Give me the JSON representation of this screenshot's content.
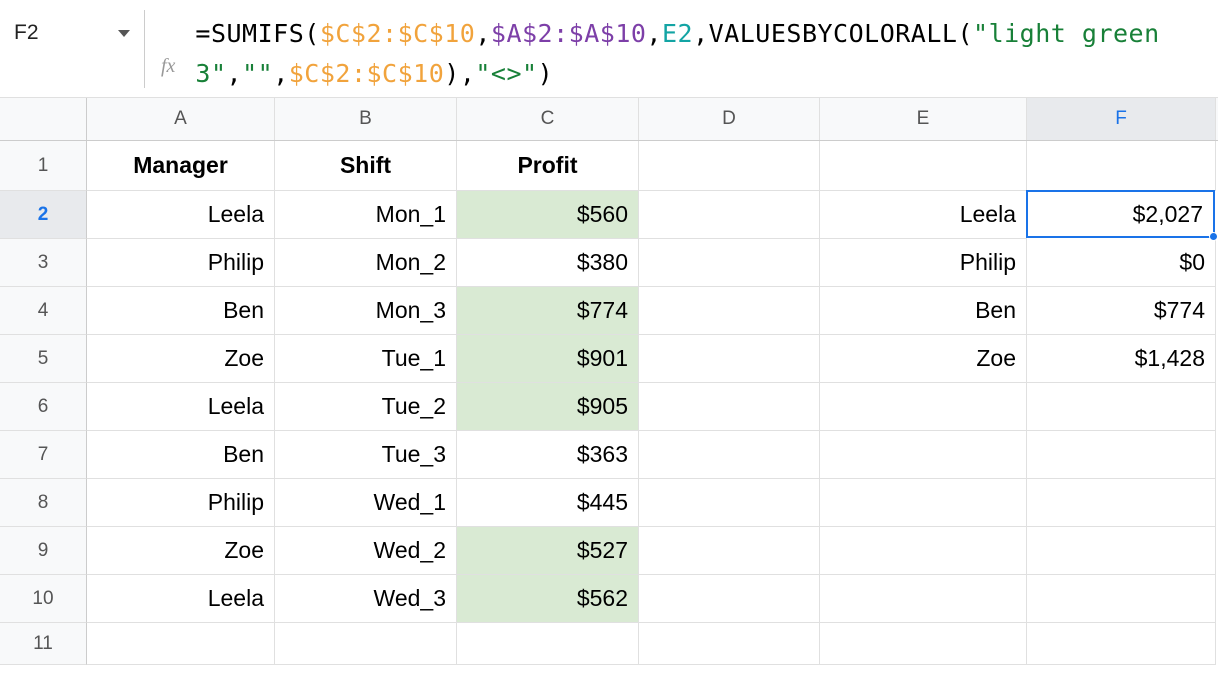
{
  "name_box": "F2",
  "fx_label": "fx",
  "formula": {
    "p1": "=SUMIFS(",
    "p2": "$C$2:$C$10",
    "p3": ",",
    "p4": "$A$2:$A$10",
    "p5": ",",
    "p6": "E2",
    "p7": ",VALUESBYCOLORALL(",
    "p8": "\"light green 3\"",
    "p9": ",",
    "p10": "\"\"",
    "p11": ",",
    "p12": "$C$2:$C$10",
    "p13": "),",
    "p14": "\"<>\"",
    "p15": ")"
  },
  "columns": [
    "A",
    "B",
    "C",
    "D",
    "E",
    "F"
  ],
  "rows": [
    "1",
    "2",
    "3",
    "4",
    "5",
    "6",
    "7",
    "8",
    "9",
    "10",
    "11"
  ],
  "headers": {
    "A": "Manager",
    "B": "Shift",
    "C": "Profit"
  },
  "data": {
    "r2": {
      "A": "Leela",
      "B": "Mon_1",
      "C": "$560",
      "E": "Leela",
      "F": "$2,027",
      "C_green": true
    },
    "r3": {
      "A": "Philip",
      "B": "Mon_2",
      "C": "$380",
      "E": "Philip",
      "F": "$0",
      "C_green": false
    },
    "r4": {
      "A": "Ben",
      "B": "Mon_3",
      "C": "$774",
      "E": "Ben",
      "F": "$774",
      "C_green": true
    },
    "r5": {
      "A": "Zoe",
      "B": "Tue_1",
      "C": "$901",
      "E": "Zoe",
      "F": "$1,428",
      "C_green": true
    },
    "r6": {
      "A": "Leela",
      "B": "Tue_2",
      "C": "$905",
      "C_green": true
    },
    "r7": {
      "A": "Ben",
      "B": "Tue_3",
      "C": "$363",
      "C_green": false
    },
    "r8": {
      "A": "Philip",
      "B": "Wed_1",
      "C": "$445",
      "C_green": false
    },
    "r9": {
      "A": "Zoe",
      "B": "Wed_2",
      "C": "$527",
      "C_green": true
    },
    "r10": {
      "A": "Leela",
      "B": "Wed_3",
      "C": "$562",
      "C_green": true
    }
  },
  "selected_cell": "F2",
  "active_row": "2",
  "active_col": "F"
}
